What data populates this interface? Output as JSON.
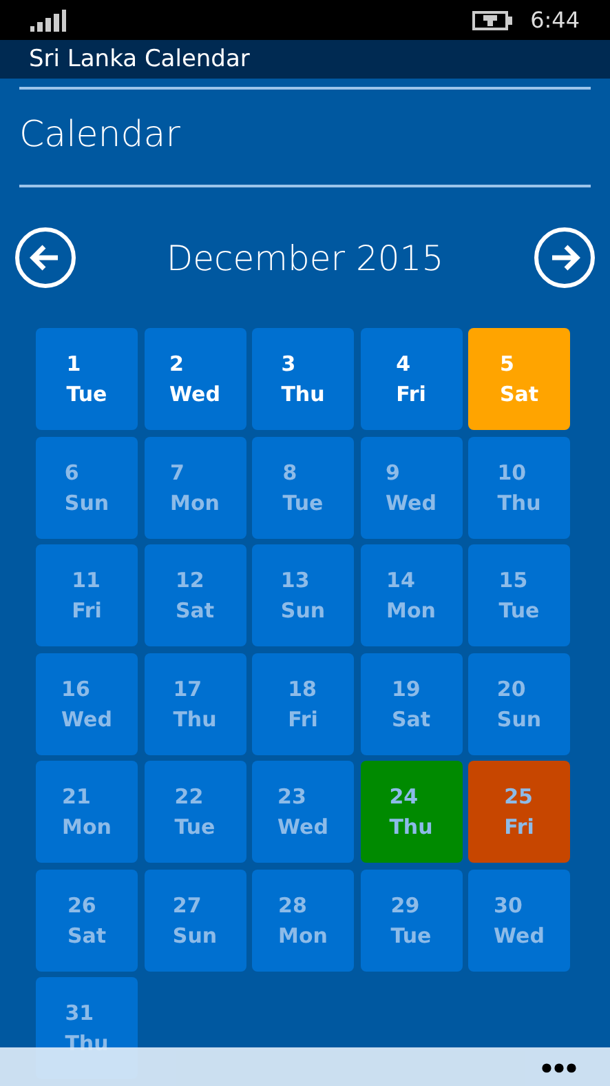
{
  "status_bar": {
    "time": "6:44"
  },
  "app_title": "Sri Lanka Calendar",
  "page_title": "Calendar",
  "month_nav": {
    "month": "December 2015"
  },
  "days": [
    {
      "number": "1",
      "weekday": "Tue",
      "muted": false
    },
    {
      "number": "2",
      "weekday": "Wed",
      "muted": false
    },
    {
      "number": "3",
      "weekday": "Thu",
      "muted": false
    },
    {
      "number": "4",
      "weekday": "Fri",
      "muted": false
    },
    {
      "number": "5",
      "weekday": "Sat",
      "muted": false,
      "color": "#ffa400"
    },
    {
      "number": "6",
      "weekday": "Sun",
      "muted": true
    },
    {
      "number": "7",
      "weekday": "Mon",
      "muted": true
    },
    {
      "number": "8",
      "weekday": "Tue",
      "muted": true
    },
    {
      "number": "9",
      "weekday": "Wed",
      "muted": true
    },
    {
      "number": "10",
      "weekday": "Thu",
      "muted": true
    },
    {
      "number": "11",
      "weekday": "Fri",
      "muted": true
    },
    {
      "number": "12",
      "weekday": "Sat",
      "muted": true
    },
    {
      "number": "13",
      "weekday": "Sun",
      "muted": true
    },
    {
      "number": "14",
      "weekday": "Mon",
      "muted": true
    },
    {
      "number": "15",
      "weekday": "Tue",
      "muted": true
    },
    {
      "number": "16",
      "weekday": "Wed",
      "muted": true
    },
    {
      "number": "17",
      "weekday": "Thu",
      "muted": true
    },
    {
      "number": "18",
      "weekday": "Fri",
      "muted": true
    },
    {
      "number": "19",
      "weekday": "Sat",
      "muted": true
    },
    {
      "number": "20",
      "weekday": "Sun",
      "muted": true
    },
    {
      "number": "21",
      "weekday": "Mon",
      "muted": true
    },
    {
      "number": "22",
      "weekday": "Tue",
      "muted": true
    },
    {
      "number": "23",
      "weekday": "Wed",
      "muted": true
    },
    {
      "number": "24",
      "weekday": "Thu",
      "muted": true,
      "color": "#008a00"
    },
    {
      "number": "25",
      "weekday": "Fri",
      "muted": true,
      "color": "#c74600"
    },
    {
      "number": "26",
      "weekday": "Sat",
      "muted": true
    },
    {
      "number": "27",
      "weekday": "Sun",
      "muted": true
    },
    {
      "number": "28",
      "weekday": "Mon",
      "muted": true
    },
    {
      "number": "29",
      "weekday": "Tue",
      "muted": true
    },
    {
      "number": "30",
      "weekday": "Wed",
      "muted": true
    },
    {
      "number": "31",
      "weekday": "Thu",
      "muted": true
    }
  ]
}
